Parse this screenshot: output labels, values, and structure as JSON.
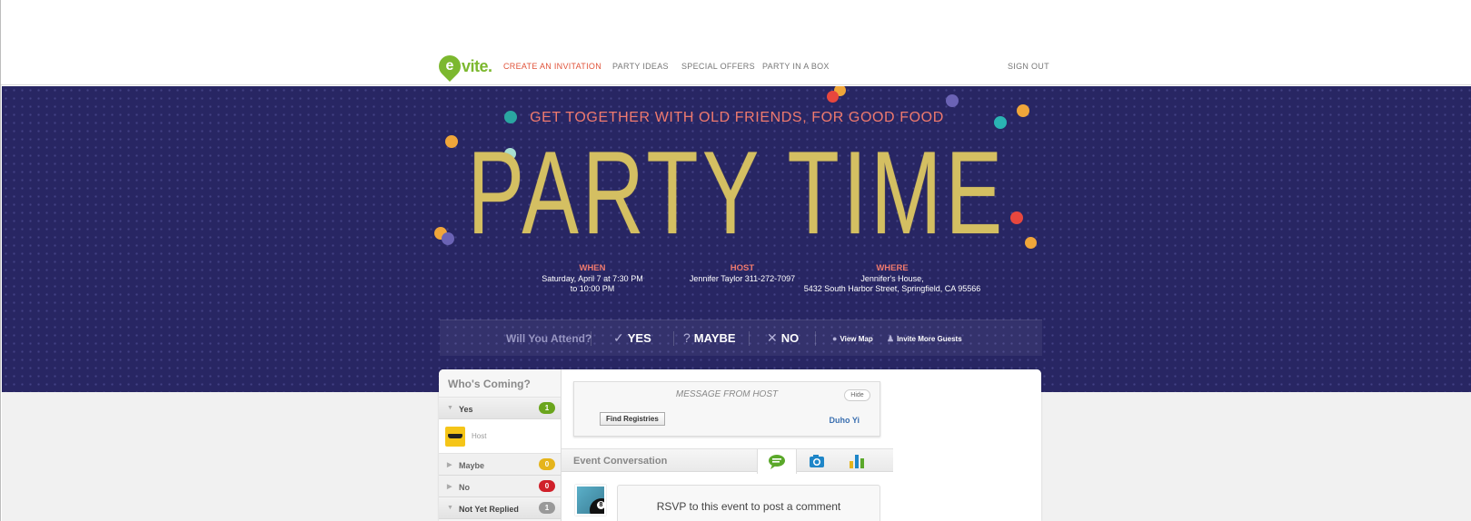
{
  "nav": {
    "logo_letter": "e",
    "logo_text": "vite.",
    "links": [
      "CREATE AN INVITATION",
      "PARTY IDEAS",
      "SPECIAL OFFERS",
      "PARTY IN A BOX"
    ],
    "sign_out": "SIGN OUT"
  },
  "event": {
    "tagline": "GET TOGETHER WITH OLD FRIENDS, FOR GOOD FOOD",
    "title": "PARTY TIME",
    "when_label": "WHEN",
    "when_line1": "Saturday, April 7 at 7:30 PM",
    "when_line2": "to 10:00 PM",
    "host_label": "HOST",
    "host_value": "Jennifer Taylor  311-272-7097",
    "where_label": "WHERE",
    "where_line1": "Jennifer's House,",
    "where_line2": "5432 South Harbor Street, Springfield, CA 95566"
  },
  "rsvp": {
    "question": "Will You Attend?",
    "yes": "YES",
    "maybe": "MAYBE",
    "no": "NO",
    "view_map": "View Map",
    "invite_more": "Invite More Guests"
  },
  "sidebar": {
    "title": "Who's Coming?",
    "groups": [
      {
        "label": "Yes",
        "count": "1",
        "color": "#6aa51c"
      },
      {
        "label": "Maybe",
        "count": "0",
        "color": "#e5b41b"
      },
      {
        "label": "No",
        "count": "0",
        "color": "#d0202a"
      },
      {
        "label": "Not Yet Replied",
        "count": "1",
        "color": "#999999"
      }
    ],
    "host_guest_label": "Host"
  },
  "message": {
    "title": "MESSAGE FROM HOST",
    "hide": "Hide",
    "find_registries": "Find Registries",
    "host_name": "Duho Yi"
  },
  "conversation": {
    "title": "Event Conversation",
    "tabs": [
      "chat-bubble-icon",
      "camera-icon",
      "bar-chart-icon"
    ],
    "comment_prompt": "RSVP to this event to post a comment"
  },
  "colors": {
    "hero_bg": "#282663",
    "accent_coral": "#f07a6e",
    "gold": "#d4bf62",
    "brand_green": "#7cb82f"
  }
}
